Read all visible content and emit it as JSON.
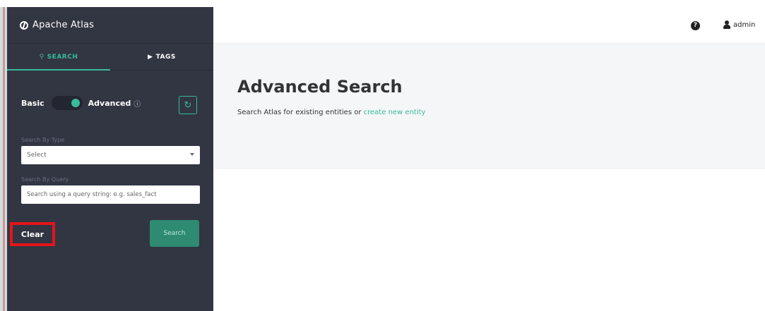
{
  "brand": {
    "title": "Apache Atlas"
  },
  "tabs": [
    {
      "label": "SEARCH",
      "active": true
    },
    {
      "label": "TAGS",
      "active": false
    }
  ],
  "search_mode": {
    "basic_label": "Basic",
    "advanced_label": "Advanced",
    "help_glyph": "?",
    "advanced_enabled": true
  },
  "fields": {
    "type_label": "Search By Type",
    "type_value": "Select",
    "query_label": "Search By Query",
    "query_placeholder": "Search using a query string: e.g. sales_fact"
  },
  "buttons": {
    "clear": "Clear",
    "search": "Search"
  },
  "topbar": {
    "help_glyph": "?",
    "user": "admin"
  },
  "main": {
    "heading": "Advanced Search",
    "subtitle_prefix": "Search Atlas for existing entities or ",
    "subtitle_link": "create new entity"
  },
  "colors": {
    "sidebar_bg": "#323542",
    "accent": "#37bb9b",
    "highlight_border": "#e3151b",
    "hero_bg": "#f5f6f8"
  }
}
